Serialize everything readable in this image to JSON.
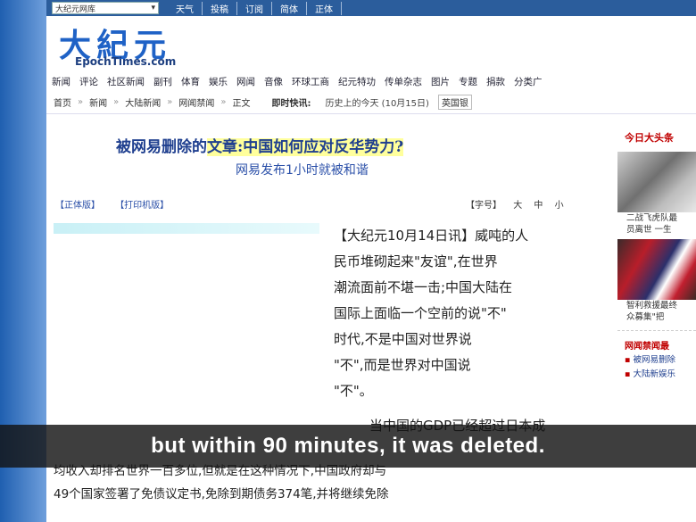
{
  "topbar": {
    "select_value": "大纪元网库",
    "links": [
      "天气",
      "投稿",
      "订阅",
      "简体",
      "正体"
    ]
  },
  "logo": {
    "chinese": "大紀元",
    "english": "EpochTimes.com"
  },
  "nav": [
    "新闻",
    "评论",
    "社区新闻",
    "副刊",
    "体育",
    "娱乐",
    "网闻",
    "音像",
    "环球工商",
    "纪元特功",
    "传单杂志",
    "图片",
    "专题",
    "捐款",
    "分类广"
  ],
  "breadcrumb": {
    "items": [
      "首页",
      "新闻",
      "大陆新闻",
      "网闻禁闻",
      "正文"
    ],
    "quick_label": "即时快讯:",
    "history": "历史上的今天 (10月15日)",
    "boxed": "英国银"
  },
  "article": {
    "title_prefix": "被网易删除的",
    "title_highlight": "文章:中国如何应对反华势力?",
    "subtitle": "网易发布1小时就被和谐",
    "tools": [
      "【正体版】",
      "【打印机版】"
    ],
    "font_size_label": "【字号】",
    "font_sizes": [
      "大",
      "中",
      "小"
    ],
    "line1": "【大纪元10月14日讯】威吨的人",
    "line2": "民币堆砌起来\"友谊\",在世界",
    "line3": "潮流面前不堪一击;中国大陆在",
    "line4": "国际上面临一个空前的说\"不\"",
    "line5": "时代,不是中国对世界说",
    "line6": "\"不\",而是世界对中国说",
    "line7": "\"不\"。",
    "line8": "当中国的GDP已经超过日本成",
    "line9": "均收入却排名世界一百多位,但就是在这种情况下,中国政府却与",
    "line10": "49个国家签署了免债议定书,免除到期债务374笔,并将继续免除"
  },
  "sidebar": {
    "head": "今日大头条",
    "caption1_a": "二战飞虎队最",
    "caption1_b": "员离世 一生",
    "caption2_a": "智利救援最终",
    "caption2_b": "众募集\"把",
    "section": "网闻禁闻最",
    "links": [
      "被网易删除",
      "大陆新娱乐"
    ]
  },
  "subtitle_caption": "but within 90 minutes, it was deleted."
}
